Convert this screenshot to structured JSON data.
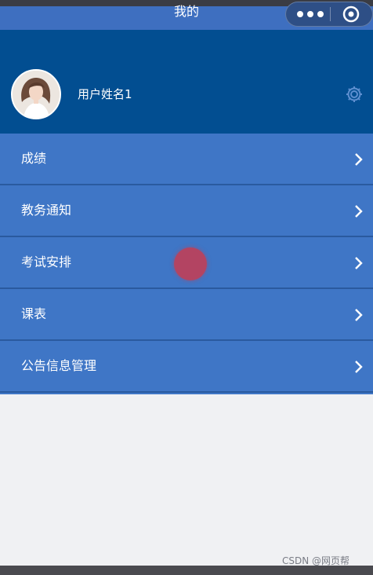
{
  "navbar": {
    "title": "我的",
    "capsule": {
      "menu_icon": "more-dots-icon",
      "close_icon": "target-circle-icon"
    }
  },
  "profile": {
    "username": "用户姓名1",
    "avatar_icon": "user-avatar",
    "settings_icon": "gear-icon"
  },
  "menu": {
    "items": [
      {
        "label": "成绩"
      },
      {
        "label": "教务通知"
      },
      {
        "label": "考试安排"
      },
      {
        "label": "课表"
      },
      {
        "label": "公告信息管理"
      }
    ]
  },
  "watermark": "CSDN @网页帮",
  "colors": {
    "navbar": "#3e6fc0",
    "profile_bg": "#024e91",
    "menu_bg": "#3f76c6",
    "page_bg": "#f0f1f3"
  }
}
